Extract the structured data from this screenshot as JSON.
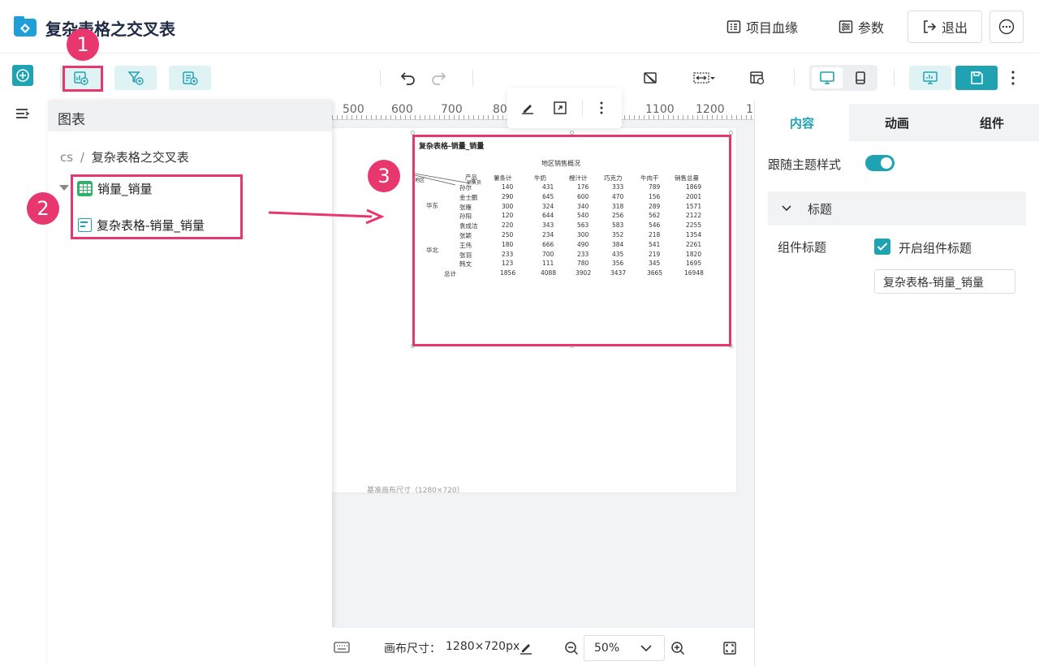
{
  "app": {
    "title": "复杂表格之交叉表"
  },
  "header": {
    "lineage_label": "项目血缘",
    "params_label": "参数",
    "exit_label": "退出"
  },
  "chart_panel": {
    "title": "图表",
    "breadcrumb_root": "cs",
    "breadcrumb_sep": "/",
    "breadcrumb_current": "复杂表格之交叉表",
    "dataset_label": "销量_销量",
    "table_label": "复杂表格-销量_销量"
  },
  "ruler": {
    "labels": [
      "500",
      "600",
      "700",
      "80",
      "1100",
      "1200",
      "1"
    ]
  },
  "canvas": {
    "page_caption": "基准画布尺寸（1280×720）"
  },
  "widget": {
    "title": "复杂表格-销量_销量",
    "caption": "地区销售概况",
    "corner_top": "产品",
    "corner_left": "地区",
    "corner_mid": "销售员",
    "columns": [
      "薯条计",
      "牛奶",
      "橙汁计",
      "巧克力",
      "牛肉干",
      "销售总量"
    ],
    "regions": [
      "华东",
      "华北"
    ],
    "rows": [
      {
        "name": "孙尔",
        "values": [
          "140",
          "431",
          "176",
          "333",
          "789",
          "1869"
        ]
      },
      {
        "name": "金士鹏",
        "values": [
          "290",
          "645",
          "600",
          "470",
          "156",
          "2001"
        ]
      },
      {
        "name": "张雁",
        "values": [
          "300",
          "324",
          "340",
          "318",
          "289",
          "1571"
        ]
      },
      {
        "name": "孙阳",
        "values": [
          "120",
          "644",
          "540",
          "256",
          "562",
          "2122"
        ]
      },
      {
        "name": "袁成洁",
        "values": [
          "220",
          "343",
          "563",
          "583",
          "546",
          "2255"
        ]
      },
      {
        "name": "张颖",
        "values": [
          "250",
          "234",
          "300",
          "352",
          "218",
          "1354"
        ]
      },
      {
        "name": "王伟",
        "values": [
          "180",
          "666",
          "490",
          "384",
          "541",
          "2261"
        ]
      },
      {
        "name": "张羽",
        "values": [
          "233",
          "700",
          "233",
          "435",
          "219",
          "1820"
        ]
      },
      {
        "name": "韩文",
        "values": [
          "123",
          "111",
          "780",
          "356",
          "345",
          "1695"
        ]
      }
    ],
    "total": {
      "name": "总计",
      "values": [
        "1856",
        "4088",
        "3902",
        "3437",
        "3665",
        "16948"
      ]
    }
  },
  "right_panel": {
    "tabs": [
      "内容",
      "动画",
      "组件"
    ],
    "follow_theme_label": "跟随主题样式",
    "follow_theme_on": true,
    "section_title": "标题",
    "widget_title_label": "组件标题",
    "enable_title_label": "开启组件标题",
    "enable_title_checked": true,
    "title_value": "复杂表格-销量_销量"
  },
  "bottom_bar": {
    "canvas_size_label": "画布尺寸：",
    "canvas_size_value": "1280×720px",
    "zoom_value": "50%"
  },
  "annotations": {
    "markers": [
      "1",
      "2",
      "3"
    ],
    "accent_color": "#e8376f"
  },
  "colors": {
    "brand": "#1fa3b3",
    "brand_light": "#dff3f5",
    "dataset_green": "#2fb36b"
  }
}
